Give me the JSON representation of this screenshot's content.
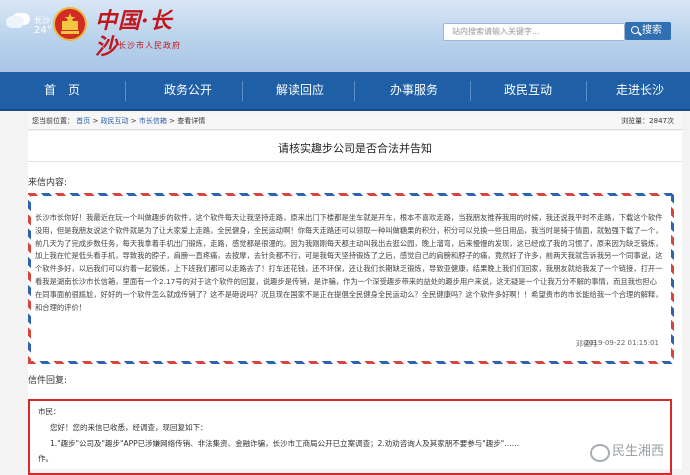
{
  "weather": {
    "city": "长沙",
    "temp": "24°",
    "icon": "cloud-icon"
  },
  "site": {
    "title": "中国·长沙",
    "subtitle": "长沙市人民政府"
  },
  "search": {
    "placeholder": "站内搜索请输入关键字...",
    "button_label": "搜索"
  },
  "nav": {
    "items": [
      {
        "label": "首　页"
      },
      {
        "label": "政务公开"
      },
      {
        "label": "解读回应"
      },
      {
        "label": "办事服务"
      },
      {
        "label": "政民互动"
      },
      {
        "label": "走进长沙"
      }
    ]
  },
  "breadcrumb": {
    "prefix": "您当前位置：",
    "items": [
      "首页",
      "政民互动",
      "市长信箱",
      "查看详情"
    ],
    "views": "浏览量：2847次"
  },
  "letter": {
    "title": "请核实趣步公司是否合法并告知",
    "section_label": "来信内容:",
    "body": "长沙市长你好！我最近在玩一个叫做趣步的软件，这个软件每天让我坚持走路，原来出门下楼都是坐车就是开车，根本不喜欢走路，当我朋友推荐我用的时候，我还说我平时不走路，下载这个软件没用，但是我朋友说这个软件就是为了让大家爱上走路，全民健身，全民运动啊！你每天走路还可以领取一种叫做糖果的积分，积分可以兑换一些日用品，我当时是骑于情面，就勉强下载了一个，前几天为了完成步数任务，每天我拿着手机出门锻炼，走路，感觉都是很漫的。因为我刚刚每天都主动叫我出去逛公园，晚上溜弯，后来慢慢的发现，这已经成了我的习惯了，原来因为缺乏锻炼，加上我在忙是低头看手机，导致我的脖子，肩膀一直疼痛，去按摩，去针灸都不行，可是我每天坚持锻炼了之后，感觉自己的肩膀和脖子的痛，竟然好了许多，前两天我就告诉我另一个同事说，这个软件多好，以后我们可以约着一起锻炼，上下班我们都可以走路去了！打车还花钱，还不环保，还让我们长期缺乏锻炼，导致亚健康，结果晚上我们们回家，我朋友就给我发了一个链接，打开一看我是湖南长沙市长信箱，里面有一个2.17号的对于这个软件的回复，说趣步是传销，是诈骗，作为一个深受趣步带来的益处的趣步用户来说，这无疑是一个让我万分不解的事情，而且我也担心在同事面前很尴尬，好好的一个软件怎么就成传销了？这不是砸说吗？况且现在国家不是正在提倡全民健身全民运动么？全民健康吗？这个软件多好啊！！希望贵市的市长能给我一个合理的解释，和合理的评价！",
    "author": "邓德月",
    "date": "2019-09-22 01:15:01"
  },
  "reply": {
    "section_label": "信件回复:",
    "greeting": "市民：",
    "line1": "您好！您的来信已收悉，经调查，现回复如下：",
    "line2": "1.\"趣步\"公司及\"趣步\"APP已涉嫌网络传销、非法集资、金融诈骗，长沙市工商局公开已立案调查；2.劝劝咨询人及其家朋不要参与\"趣步\"……",
    "line3": "作。"
  },
  "watermark": {
    "text": "民生湘西"
  }
}
